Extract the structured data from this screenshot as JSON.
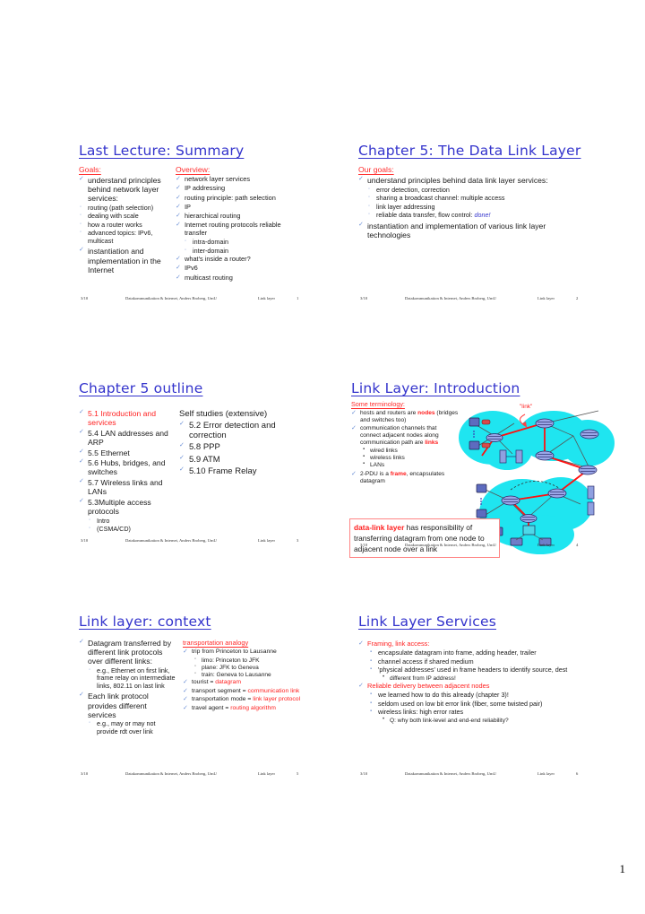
{
  "page": {
    "number": "1"
  },
  "footer_common": {
    "left": "3/10",
    "middle": "Datakommunikation & Internet, Anders Broberg, UmU",
    "right": "Link layer"
  },
  "slides": [
    {
      "id": "last-lecture-summary",
      "title": "Last Lecture: Summary",
      "page_num": "1",
      "left_heading": "Goals:",
      "left_items": [
        {
          "level": 1,
          "text": "understand principles behind network layer services:"
        },
        {
          "level": 2,
          "text": "routing (path selection)"
        },
        {
          "level": 2,
          "text": "dealing with scale"
        },
        {
          "level": 2,
          "text": "how a router works"
        },
        {
          "level": 2,
          "text": "advanced topics: IPv6, multicast"
        },
        {
          "level": 1,
          "text": "instantiation and implementation in the Internet"
        }
      ],
      "right_heading": "Overview:",
      "right_items": [
        {
          "level": 1,
          "text": "network layer services"
        },
        {
          "level": 1,
          "text": "IP addressing"
        },
        {
          "level": 1,
          "text": "routing principle: path selection"
        },
        {
          "level": 1,
          "text": "IP"
        },
        {
          "level": 1,
          "text": "hierarchical routing"
        },
        {
          "level": 1,
          "text": "Internet routing protocols reliable transfer"
        },
        {
          "level": 2,
          "text": "intra-domain"
        },
        {
          "level": 2,
          "text": "inter-domain"
        },
        {
          "level": 1,
          "text": "what's inside a router?"
        },
        {
          "level": 1,
          "text": "IPv6"
        },
        {
          "level": 1,
          "text": "multicast routing"
        }
      ]
    },
    {
      "id": "chapter-5-data-link-layer",
      "title": "Chapter 5: The Data Link Layer",
      "page_num": "2",
      "heading": "Our goals:",
      "items": [
        {
          "level": 1,
          "text": "understand principles behind data link layer services:"
        },
        {
          "level": 2,
          "text": "error detection, correction"
        },
        {
          "level": 2,
          "text": "sharing a broadcast channel: multiple access"
        },
        {
          "level": 2,
          "text": "link layer addressing"
        },
        {
          "level": 2,
          "text": "reliable data transfer, flow control: ",
          "emph": "done!"
        },
        {
          "level": 1,
          "text": "instantiation and implementation of various link layer technologies"
        }
      ]
    },
    {
      "id": "chapter-5-outline",
      "title": "Chapter 5 outline",
      "page_num": "3",
      "left_items": [
        {
          "level": 1,
          "text": "5.1 Introduction and services",
          "red": true
        },
        {
          "level": 1,
          "text": "5.4 LAN addresses and ARP"
        },
        {
          "level": 1,
          "text": "5.5 Ethernet"
        },
        {
          "level": 1,
          "text": "5.6 Hubs, bridges, and switches"
        },
        {
          "level": 1,
          "text": "5.7 Wireless links and LANs"
        },
        {
          "level": 1,
          "text": "5.3Multiple access protocols"
        },
        {
          "level": 2,
          "text": "Intro"
        },
        {
          "level": 2,
          "text": "(CSMA/CD)"
        }
      ],
      "right_heading": "Self studies (extensive)",
      "right_items": [
        {
          "level": 1,
          "text": "5.2 Error detection and correction"
        },
        {
          "level": 1,
          "text": "5.8 PPP"
        },
        {
          "level": 1,
          "text": "5.9 ATM"
        },
        {
          "level": 1,
          "text": "5.10 Frame Relay"
        }
      ]
    },
    {
      "id": "link-layer-introduction",
      "title": "Link Layer: Introduction",
      "page_num": "4",
      "heading": "Some terminology:",
      "items": [
        {
          "level": 1,
          "text": "hosts and routers are ",
          "emph": "nodes",
          "tail": " (bridges and switches too)"
        },
        {
          "level": 1,
          "text": "communication channels that connect adjacent nodes along communication path are ",
          "emph": "links"
        },
        {
          "level": 2,
          "text": "wired links"
        },
        {
          "level": 2,
          "text": "wireless links"
        },
        {
          "level": 2,
          "text": "LANs"
        },
        {
          "level": 1,
          "text": "2-PDU is a ",
          "emph": "frame",
          "tail": ", encapsulates datagram"
        }
      ],
      "callout": {
        "emph": "data-link layer",
        "text": " has responsibility of transferring datagram from one node to adjacent node over a link"
      },
      "diagram_label": "\"link\""
    },
    {
      "id": "link-layer-context",
      "title": "Link layer: context",
      "page_num": "5",
      "left_items": [
        {
          "level": 1,
          "text": "Datagram transferred by different link protocols over different links:"
        },
        {
          "level": 2,
          "text": "e.g., Ethernet on first link, frame relay on intermediate links, 802.11 on last link"
        },
        {
          "level": 1,
          "text": "Each  link protocol provides different services"
        },
        {
          "level": 2,
          "text": "e.g., may or may not provide rdt over link"
        }
      ],
      "right_heading": "transportation analogy",
      "right_items": [
        {
          "level": 1,
          "text": "trip from Princeton to Lausanne"
        },
        {
          "level": 2,
          "text": "limo: Princeton to JFK"
        },
        {
          "level": 2,
          "text": "plane: JFK to Geneva"
        },
        {
          "level": 2,
          "text": "train: Geneva to Lausanne"
        },
        {
          "level": 1,
          "text": "tourist = ",
          "emph": "datagram"
        },
        {
          "level": 1,
          "text": "transport segment = ",
          "emph": "communication link"
        },
        {
          "level": 1,
          "text": "transportation mode = ",
          "emph": "link layer protocol"
        },
        {
          "level": 1,
          "text": "travel agent = ",
          "emph": "routing algorithm"
        }
      ]
    },
    {
      "id": "link-layer-services",
      "title": "Link Layer Services",
      "page_num": "6",
      "items": [
        {
          "level": 1,
          "text": "Framing, link access:",
          "red": true
        },
        {
          "level": 2,
          "text": "encapsulate datagram into frame, adding header, trailer"
        },
        {
          "level": 2,
          "text": "channel access if shared medium"
        },
        {
          "level": 2,
          "text": "'physical addresses' used in frame headers to identify source, dest"
        },
        {
          "level": 3,
          "text": "different from IP address!"
        },
        {
          "level": 1,
          "text": "Reliable delivery between adjacent nodes",
          "red": true
        },
        {
          "level": 2,
          "text": "we learned how to do this already (chapter 3)!"
        },
        {
          "level": 2,
          "text": "seldom used on low bit error link (fiber, some twisted pair)"
        },
        {
          "level": 2,
          "text": "wireless links: high error rates"
        },
        {
          "level": 3,
          "text": "Q: why both link-level and end-end reliability?"
        }
      ]
    }
  ],
  "colors": {
    "title_blue": "#3333cc",
    "accent_red": "#ff2020",
    "blob_cyan": "#1fe5f0",
    "link_red": "#ff1010"
  }
}
